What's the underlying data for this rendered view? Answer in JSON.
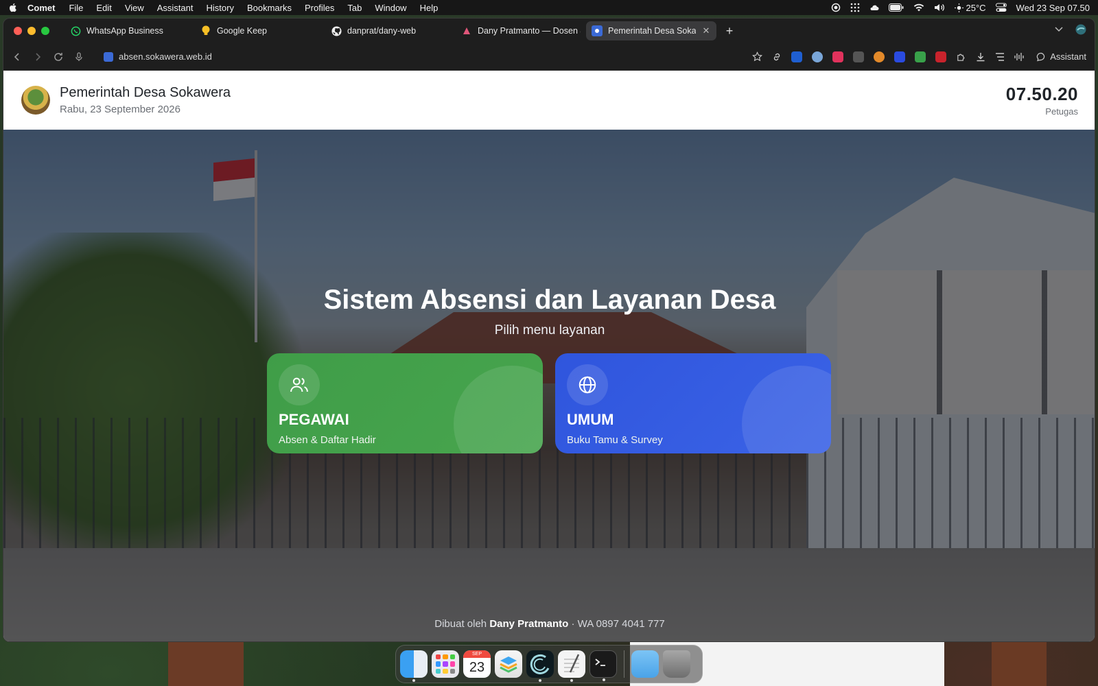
{
  "menubar": {
    "app_name": "Comet",
    "menus": [
      "File",
      "Edit",
      "View",
      "Assistant",
      "History",
      "Bookmarks",
      "Profiles",
      "Tab",
      "Window",
      "Help"
    ],
    "temperature": "25°C",
    "datetime": "Wed 23 Sep  07.50"
  },
  "tabs": [
    {
      "label": "WhatsApp Business",
      "icon": "whatsapp-icon",
      "active": false
    },
    {
      "label": "Google Keep",
      "icon": "keep-bulb-icon",
      "active": false
    },
    {
      "label": "danprat/dany-web",
      "icon": "github-icon",
      "active": false
    },
    {
      "label": "Dany Pratmanto — Dosen &",
      "icon": "site-icon",
      "active": false
    },
    {
      "label": "Pemerintah Desa Sokawera",
      "icon": "site-icon",
      "active": true
    }
  ],
  "toolbar": {
    "url": "absen.sokawera.web.id",
    "assistant_label": "Assistant"
  },
  "header": {
    "title": "Pemerintah Desa Sokawera",
    "date": "Rabu, 23 September 2026",
    "clock": "07.50.20",
    "role": "Petugas"
  },
  "hero": {
    "title": "Sistem Absensi dan Layanan Desa",
    "subtitle": "Pilih menu layanan"
  },
  "cards": [
    {
      "title": "PEGAWAI",
      "subtitle": "Absen & Daftar Hadir",
      "icon": "users-icon",
      "color": "#43a04b"
    },
    {
      "title": "UMUM",
      "subtitle": "Buku Tamu & Survey",
      "icon": "globe-icon",
      "color": "#3359e0"
    }
  ],
  "footer": {
    "prefix": "Dibuat oleh",
    "author": "Dany Pratmanto",
    "contact": "· WA 0897 4041 777"
  },
  "dock": {
    "calendar_month": "SEP",
    "calendar_day": "23"
  },
  "colors": {
    "accent_green": "#43a04b",
    "accent_blue": "#3359e0"
  }
}
